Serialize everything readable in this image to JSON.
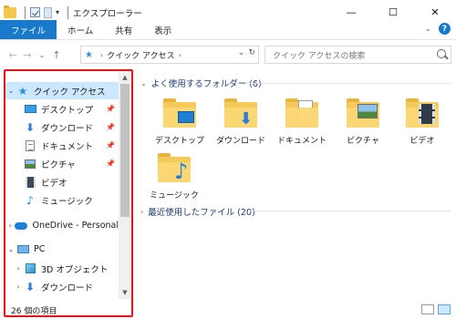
{
  "window": {
    "title": "エクスプローラー",
    "controls": {
      "minimize": "—",
      "maximize": "☐",
      "close": "✕"
    }
  },
  "ribbon": {
    "tabs": [
      "ファイル",
      "ホーム",
      "共有",
      "表示"
    ],
    "help": "?"
  },
  "address_bar": {
    "nav": {
      "back": "←",
      "forward": "→",
      "recent": "⌄",
      "up": "↑"
    },
    "path": "クイック アクセス",
    "separator": "›",
    "dropdown": "⌄",
    "refresh": "↻"
  },
  "search": {
    "placeholder": "クイック アクセスの検索"
  },
  "nav_pane": {
    "items": [
      {
        "label": "クイック アクセス",
        "icon": "star-icon",
        "expand": "⌄",
        "selected": true
      },
      {
        "label": "デスクトップ",
        "icon": "desktop-icon",
        "pinned": true
      },
      {
        "label": "ダウンロード",
        "icon": "download-icon",
        "pinned": true
      },
      {
        "label": "ドキュメント",
        "icon": "document-icon",
        "pinned": true
      },
      {
        "label": "ピクチャ",
        "icon": "picture-icon",
        "pinned": true
      },
      {
        "label": "ビデオ",
        "icon": "video-icon"
      },
      {
        "label": "ミュージック",
        "icon": "music-icon"
      },
      {
        "label": "OneDrive - Personal",
        "icon": "cloud-icon",
        "expand": "›"
      },
      {
        "label": "PC",
        "icon": "pc-icon",
        "expand": "⌄"
      },
      {
        "label": "3D オブジェクト",
        "icon": "3d-objects-icon",
        "expand": "›"
      },
      {
        "label": "ダウンロード",
        "icon": "download-icon",
        "expand": "›"
      }
    ],
    "pin_glyph": "📌"
  },
  "content": {
    "frequent_header": "よく使用するフォルダー (6)",
    "recent_header": "最近使用したファイル (20)",
    "folders": [
      {
        "label": "デスクトップ",
        "icon": "desktop-folder-icon"
      },
      {
        "label": "ダウンロード",
        "icon": "download-folder-icon"
      },
      {
        "label": "ドキュメント",
        "icon": "documents-folder-icon"
      },
      {
        "label": "ピクチャ",
        "icon": "pictures-folder-icon"
      },
      {
        "label": "ビデオ",
        "icon": "videos-folder-icon"
      },
      {
        "label": "ミュージック",
        "icon": "music-folder-icon"
      }
    ]
  },
  "status_bar": {
    "count": "26 個の項目"
  },
  "colors": {
    "accent": "#1979ca",
    "selection": "#cce8ff",
    "highlight_border": "#e8141c"
  }
}
